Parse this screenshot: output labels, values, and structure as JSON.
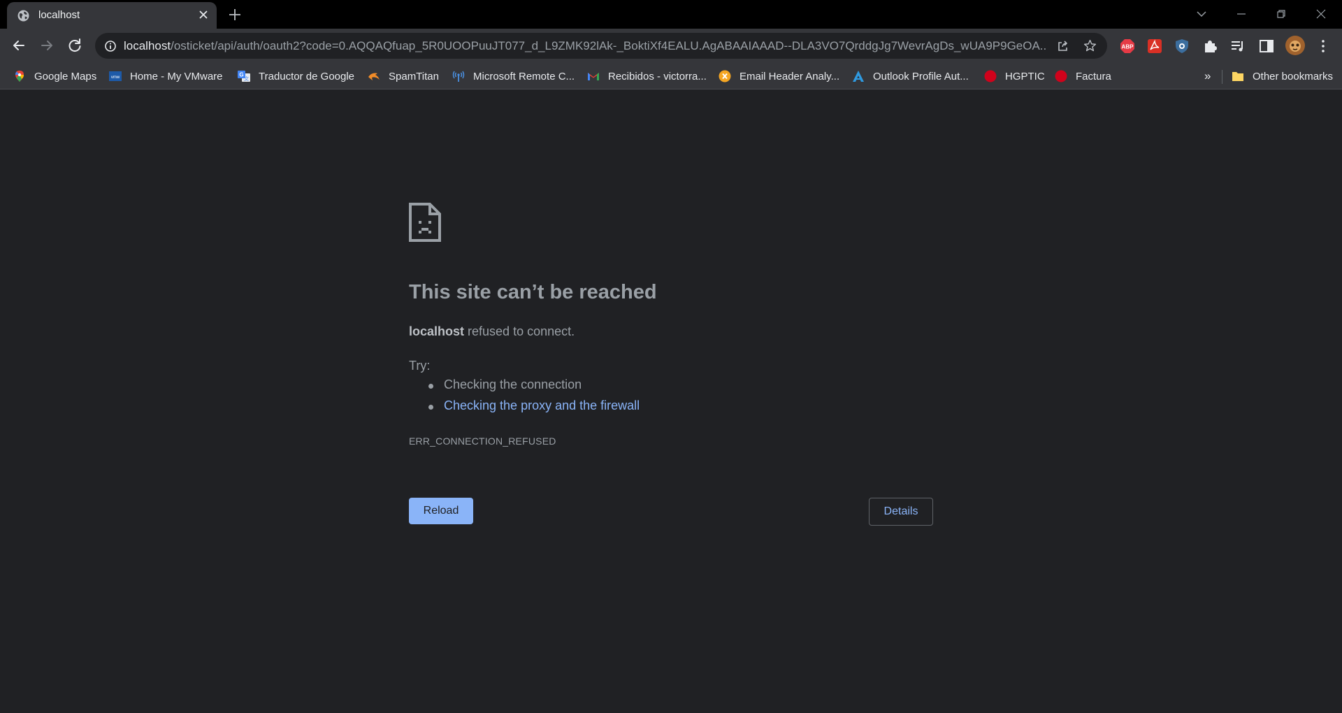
{
  "tab": {
    "title": "localhost"
  },
  "address_bar": {
    "host": "localhost",
    "path": "/osticket/api/auth/oauth2?code=0.AQQAQfuap_5R0UOOPuuJT077_d_L9ZMK92lAk-_BoktiXf4EALU.AgABAAIAAAD--DLA3VO7QrddgJg7WevrAgDs_wUA9P9GeOA..."
  },
  "extensions": [
    {
      "name": "adblock-plus",
      "label": "ABP",
      "color": "#e63a45"
    },
    {
      "name": "acrobat",
      "color": "#e8463a"
    },
    {
      "name": "shield-extension",
      "color": "#5b9bd5"
    }
  ],
  "bookmarks": [
    {
      "label": "Google Maps",
      "icon": "google-maps"
    },
    {
      "label": "Home - My VMware",
      "icon": "vmware"
    },
    {
      "label": "Traductor de Google",
      "icon": "google-translate"
    },
    {
      "label": "SpamTitan",
      "icon": "spamtitan"
    },
    {
      "label": "Microsoft Remote C...",
      "icon": "remote-desktop"
    },
    {
      "label": "Recibidos - victorra...",
      "icon": "gmail"
    },
    {
      "label": "Email Header Analy...",
      "icon": "email-header"
    },
    {
      "label": "Outlook Profile Aut...",
      "icon": "outlook-profile"
    },
    {
      "label": "HGPTIC",
      "icon": "red-circle"
    },
    {
      "label": "Factura",
      "icon": "red-circle"
    }
  ],
  "bookmarks_overflow": "»",
  "other_bookmarks": "Other bookmarks",
  "error": {
    "title": "This site can’t be reached",
    "host": "localhost",
    "description": "refused to connect.",
    "try_label": "Try:",
    "suggestions": [
      "Checking the connection",
      "Checking the proxy and the firewall"
    ],
    "code": "ERR_CONNECTION_REFUSED",
    "reload_label": "Reload",
    "details_label": "Details"
  },
  "colors": {
    "background": "#202124",
    "toolbar": "#35363a",
    "link": "#8ab4f8",
    "text": "#9aa0a6"
  }
}
